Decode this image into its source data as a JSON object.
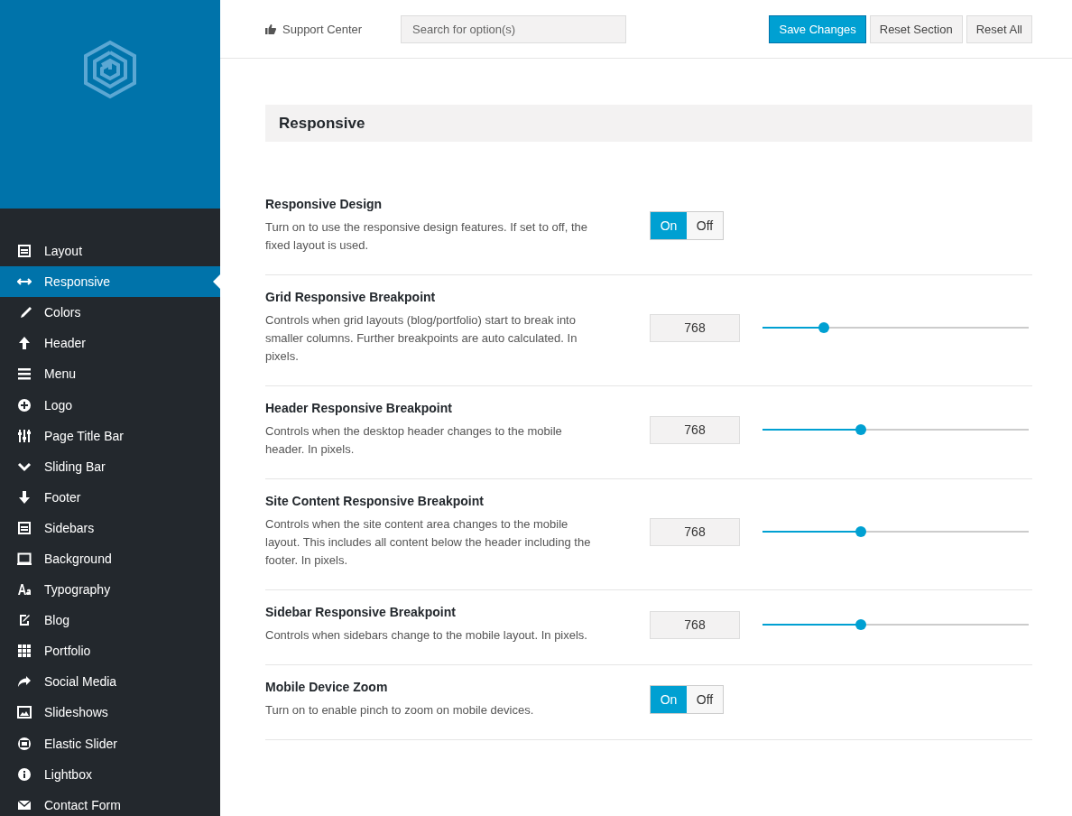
{
  "sidebar": {
    "items": [
      {
        "label": "Layout",
        "selected": false
      },
      {
        "label": "Responsive",
        "selected": true
      },
      {
        "label": "Colors",
        "selected": false
      },
      {
        "label": "Header",
        "selected": false
      },
      {
        "label": "Menu",
        "selected": false
      },
      {
        "label": "Logo",
        "selected": false
      },
      {
        "label": "Page Title Bar",
        "selected": false
      },
      {
        "label": "Sliding Bar",
        "selected": false
      },
      {
        "label": "Footer",
        "selected": false
      },
      {
        "label": "Sidebars",
        "selected": false
      },
      {
        "label": "Background",
        "selected": false
      },
      {
        "label": "Typography",
        "selected": false
      },
      {
        "label": "Blog",
        "selected": false
      },
      {
        "label": "Portfolio",
        "selected": false
      },
      {
        "label": "Social Media",
        "selected": false
      },
      {
        "label": "Slideshows",
        "selected": false
      },
      {
        "label": "Elastic Slider",
        "selected": false
      },
      {
        "label": "Lightbox",
        "selected": false
      },
      {
        "label": "Contact Form",
        "selected": false
      }
    ]
  },
  "topbar": {
    "support_link": "Support Center",
    "search": {
      "placeholder": "Search for option(s)"
    },
    "buttons": [
      {
        "label": "Save Changes",
        "primary": true
      },
      {
        "label": "Reset Section",
        "primary": false
      },
      {
        "label": "Reset All",
        "primary": false
      }
    ]
  },
  "section": {
    "title": "Responsive",
    "options": [
      {
        "kind": "toggle",
        "title": "Responsive Design",
        "description": "Turn on to use the responsive design features. If set to off, the fixed layout is used.",
        "choices": [
          {
            "label": "On",
            "selected": true
          },
          {
            "label": "Off",
            "selected": false
          }
        ]
      },
      {
        "kind": "slider",
        "title": "Grid Responsive Breakpoint",
        "description": "Controls when grid layouts (blog/portfolio) start to break into smaller columns. Further breakpoints are auto calculated. In pixels.",
        "value": "768",
        "level": 0.23
      },
      {
        "kind": "slider",
        "title": "Header Responsive Breakpoint",
        "description": "Controls when the desktop header changes to the mobile header. In pixels.",
        "value": "768",
        "level": 0.37
      },
      {
        "kind": "slider",
        "title": "Site Content Responsive Breakpoint",
        "description": "Controls when the site content area changes to the mobile layout. This includes all content below the header including the footer. In pixels.",
        "value": "768",
        "level": 0.37
      },
      {
        "kind": "slider",
        "title": "Sidebar Responsive Breakpoint",
        "description": "Controls when sidebars change to the mobile layout. In pixels.",
        "value": "768",
        "level": 0.37
      },
      {
        "kind": "toggle",
        "title": "Mobile Device Zoom",
        "description": "Turn on to enable pinch to zoom on mobile devices.",
        "choices": [
          {
            "label": "On",
            "selected": true
          },
          {
            "label": "Off",
            "selected": false
          }
        ]
      }
    ]
  }
}
